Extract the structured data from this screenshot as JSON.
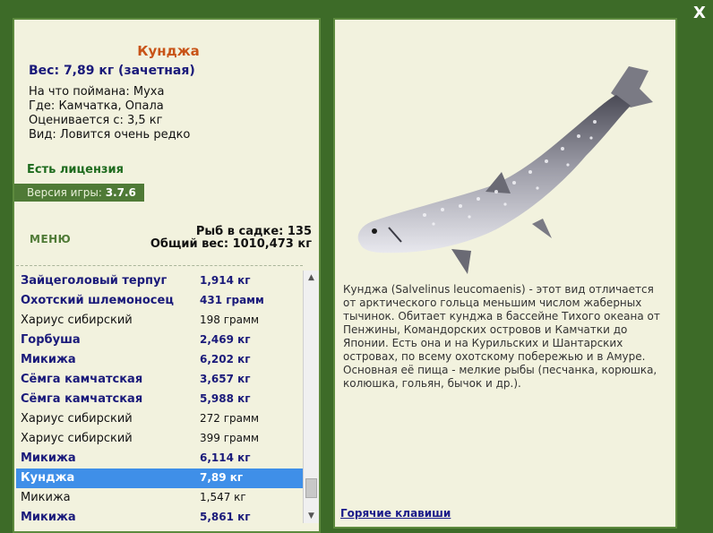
{
  "close_label": "X",
  "fish": {
    "name": "Кунджа",
    "weight_line": "Вес: 7,89 кг (зачетная)",
    "details": [
      {
        "label": "На что поймана:",
        "value": "Муха"
      },
      {
        "label": "Где:",
        "value": "Камчатка, Опала"
      },
      {
        "label": "Оценивается с:",
        "value": "3,5 кг"
      },
      {
        "label": "Вид:",
        "value": "Ловится очень редко"
      }
    ]
  },
  "license": "Есть лицензия",
  "version": {
    "label": "Версия игры:",
    "value": "3.7.6"
  },
  "menu_label": "МЕНЮ",
  "stats": {
    "fish_count": "Рыб в садке: 135",
    "total_weight": "Общий вес: 1010,473 кг"
  },
  "catch_list": [
    {
      "name": "Зайцеголовый терпуг",
      "weight": "1,914 кг",
      "bold": true
    },
    {
      "name": "Охотский шлемоносец",
      "weight": "431 грамм",
      "bold": true
    },
    {
      "name": "Хариус сибирский",
      "weight": "198 грамм",
      "bold": false
    },
    {
      "name": "Горбуша",
      "weight": "2,469 кг",
      "bold": true
    },
    {
      "name": "Микижа",
      "weight": "6,202 кг",
      "bold": true
    },
    {
      "name": "Сёмга камчатская",
      "weight": "3,657 кг",
      "bold": true
    },
    {
      "name": "Сёмга камчатская",
      "weight": "5,988 кг",
      "bold": true
    },
    {
      "name": "Хариус сибирский",
      "weight": "272 грамм",
      "bold": false
    },
    {
      "name": "Хариус сибирский",
      "weight": "399 грамм",
      "bold": false
    },
    {
      "name": "Микижа",
      "weight": "6,114 кг",
      "bold": true
    },
    {
      "name": "Кунджа",
      "weight": "7,89 кг",
      "bold": true,
      "selected": true
    },
    {
      "name": "Микижа",
      "weight": "1,547 кг",
      "bold": false
    },
    {
      "name": "Микижа",
      "weight": "5,861 кг",
      "bold": true
    }
  ],
  "description": "Кунджа (Salvelinus leucomaenis) - этот вид отличается от арктического гольца меньшим числом жаберных тычинок. Обитает кунджа в бассейне Тихого океана от Пенжины, Командорских островов и Камчатки до Японии. Есть она и на Курильских и Шантарских островах, по всему охотскому побережью и в Амуре. Основная её пища - мелкие рыбы (песчанка, корюшка, колюшка, гольян, бычок и др.).",
  "hotkeys_label": "Горячие клавиши"
}
